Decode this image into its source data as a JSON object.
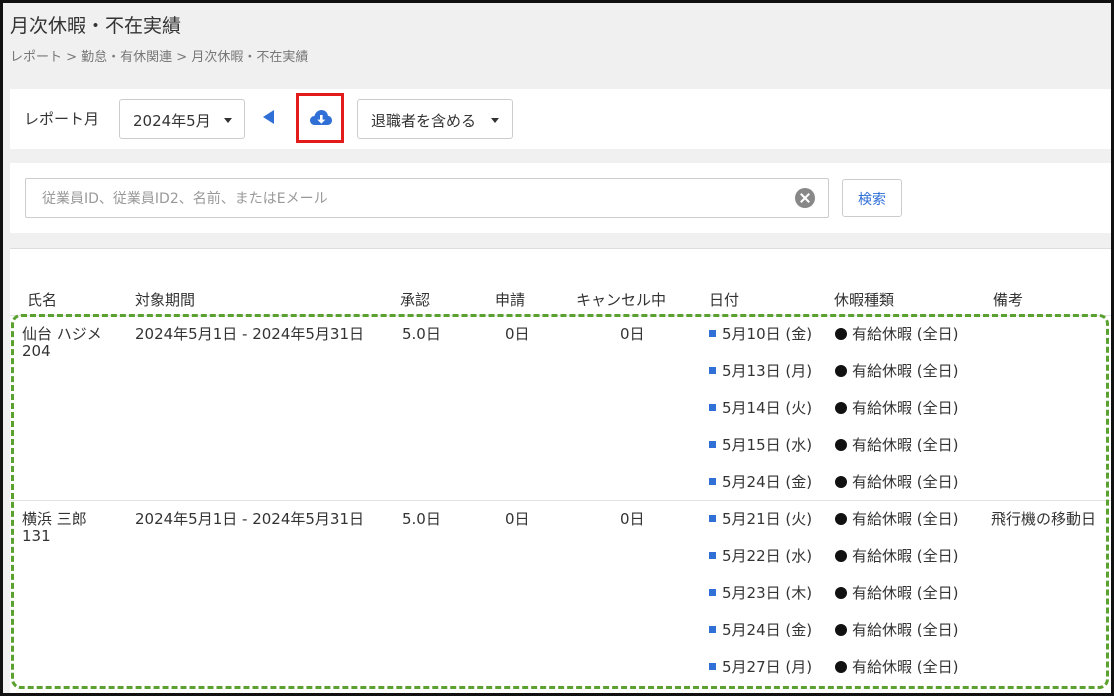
{
  "header": {
    "title": "月次休暇・不在実績",
    "breadcrumb": "レポート > 勤怠・有休関連 > 月次休暇・不在実績"
  },
  "toolbar": {
    "report_month_label": "レポート月",
    "month_value": "2024年5月",
    "retired_label": "退職者を含める"
  },
  "search": {
    "placeholder": "従業員ID、従業員ID2、名前、またはEメール",
    "button_label": "検索"
  },
  "table": {
    "columns": [
      "氏名",
      "対象期間",
      "承認",
      "申請",
      "キャンセル中",
      "日付",
      "休暇種類",
      "備考"
    ],
    "rows": [
      {
        "name": "仙台 ハジメ",
        "id": "204",
        "period": "2024年5月1日 - 2024年5月31日",
        "approved": "5.0日",
        "applied": "0日",
        "cancelling": "0日",
        "dates": [
          "5月10日 (金)",
          "5月13日 (月)",
          "5月14日 (火)",
          "5月15日 (水)",
          "5月24日 (金)"
        ],
        "types": [
          "有給休暇 (全日)",
          "有給休暇 (全日)",
          "有給休暇 (全日)",
          "有給休暇 (全日)",
          "有給休暇 (全日)"
        ],
        "note": ""
      },
      {
        "name": "横浜 三郎",
        "id": "131",
        "period": "2024年5月1日 - 2024年5月31日",
        "approved": "5.0日",
        "applied": "0日",
        "cancelling": "0日",
        "dates": [
          "5月21日 (火)",
          "5月22日 (水)",
          "5月23日 (木)",
          "5月24日 (金)",
          "5月27日 (月)"
        ],
        "types": [
          "有給休暇 (全日)",
          "有給休暇 (全日)",
          "有給休暇 (全日)",
          "有給休暇 (全日)",
          "有給休暇 (全日)"
        ],
        "note": "飛行機の移動日"
      }
    ]
  },
  "colors": {
    "accent": "#2f6fd6",
    "highlight_red": "#e31b1b",
    "highlight_green": "#5aa12f"
  },
  "icons": {
    "download": "cloud-download-icon",
    "prev": "prev-arrow-icon",
    "clear": "clear-icon"
  }
}
